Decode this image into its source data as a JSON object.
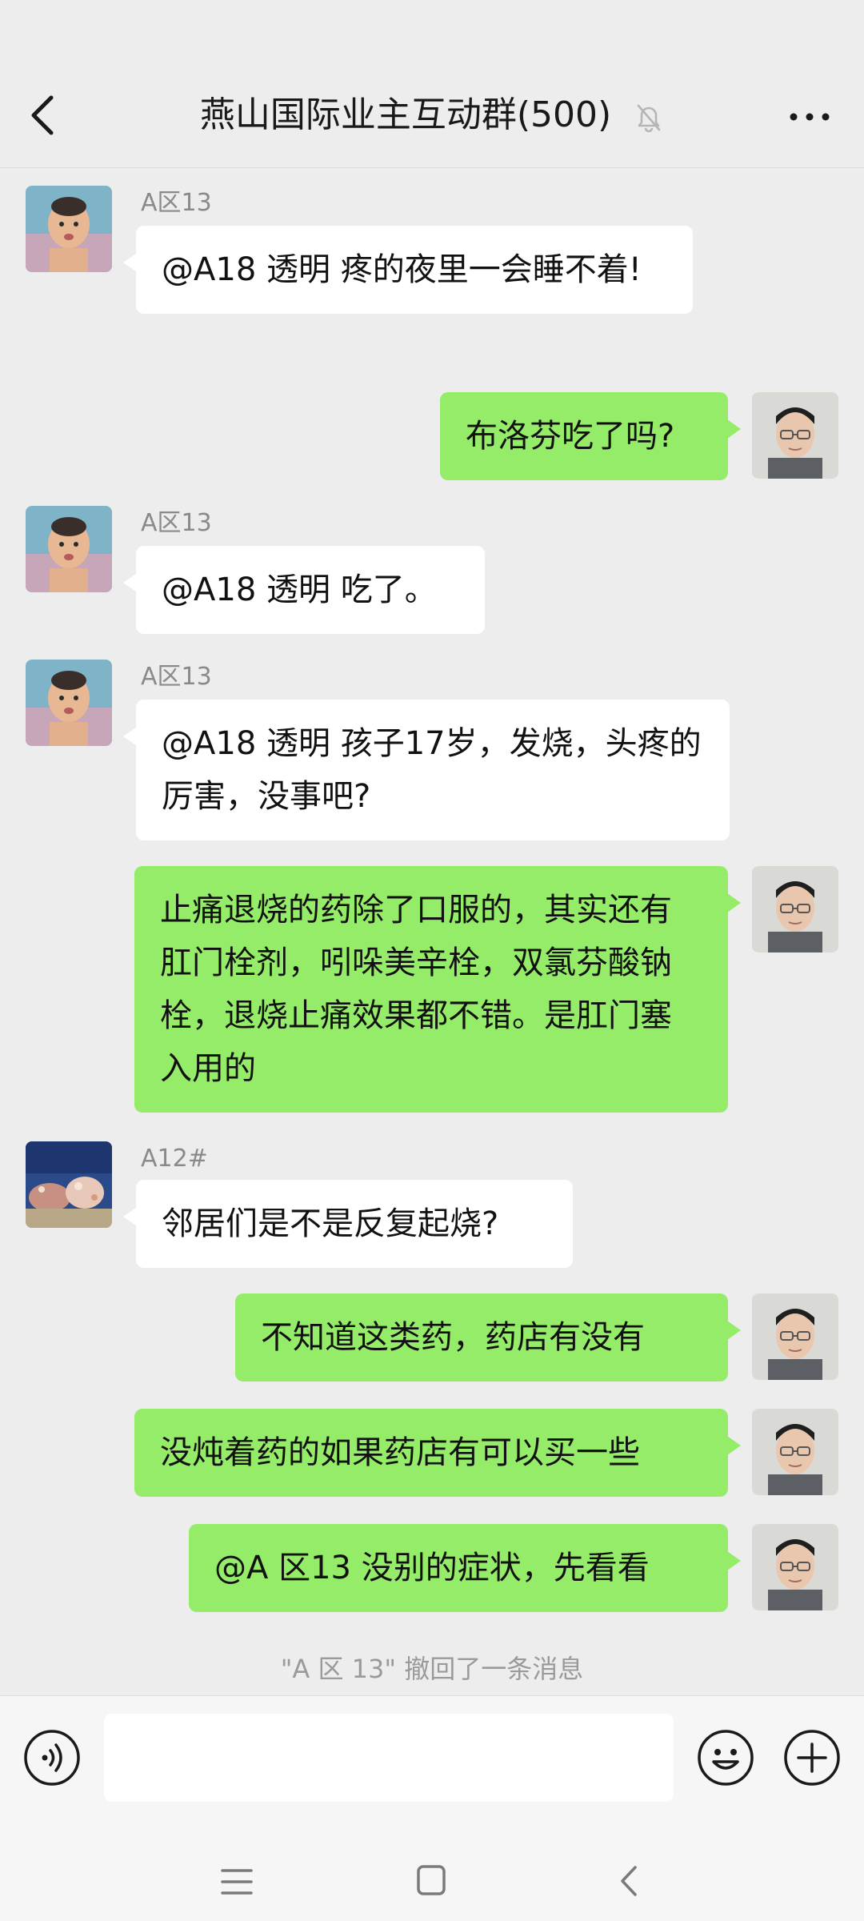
{
  "header": {
    "title": "燕山国际业主互动群(500)",
    "icons": {
      "back": "chevron-left-icon",
      "mute": "bell-off-icon",
      "more": "more-dots-icon"
    }
  },
  "messages": [
    {
      "side": "left",
      "sender": "A区13",
      "avatar": "baby-avatar",
      "text": "@A18 透明 疼的夜里一会睡不着!"
    },
    {
      "side": "right",
      "avatar": "self-avatar",
      "text": "布洛芬吃了吗?"
    },
    {
      "side": "left",
      "sender": "A区13",
      "avatar": "baby-avatar",
      "text": "@A18 透明 吃了。"
    },
    {
      "side": "left",
      "sender": "A区13",
      "avatar": "baby-avatar",
      "text": "@A18 透明 孩子17岁，发烧，头疼的厉害，没事吧?"
    },
    {
      "side": "right",
      "avatar": "self-avatar",
      "text": "止痛退烧的药除了口服的，其实还有肛门栓剂，吲哚美辛栓，双氯芬酸钠栓，退烧止痛效果都不错。是肛门塞入用的"
    },
    {
      "side": "left",
      "sender": "A12#",
      "avatar": "aquarium-avatar",
      "text": "邻居们是不是反复起烧?"
    },
    {
      "side": "right",
      "avatar": "self-avatar",
      "text": "不知道这类药，药店有没有"
    },
    {
      "side": "right",
      "avatar": "self-avatar",
      "text": "没炖着药的如果药店有可以买一些"
    },
    {
      "side": "right",
      "avatar": "self-avatar",
      "text": "@A 区13 没别的症状，先看看"
    }
  ],
  "system_note": "\"A 区 13\" 撤回了一条消息",
  "input_bar": {
    "placeholder": "",
    "icons": {
      "voice": "voice-icon",
      "emoji": "emoji-icon",
      "plus": "plus-icon"
    }
  },
  "nav_bar": {
    "icons": {
      "menu": "menu-icon",
      "home": "home-icon",
      "back": "back-icon"
    }
  },
  "colors": {
    "background": "#ededed",
    "self_bubble": "#95ec69",
    "other_bubble": "#ffffff"
  }
}
